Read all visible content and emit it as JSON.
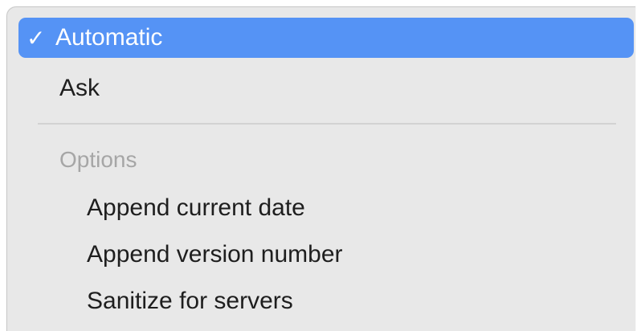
{
  "menu": {
    "items": [
      {
        "label": "Automatic",
        "checkmark": "✓",
        "selected": true
      },
      {
        "label": "Ask",
        "selected": false
      }
    ],
    "section_header": "Options",
    "options": [
      {
        "label": "Append current date"
      },
      {
        "label": "Append version number"
      },
      {
        "label": "Sanitize for servers"
      }
    ]
  },
  "colors": {
    "menu_background": "#e8e8e8",
    "highlight": "#5593f5",
    "text": "#1e1e1e",
    "disabled_text": "#a6a6a6",
    "divider": "#d2d2d2"
  }
}
